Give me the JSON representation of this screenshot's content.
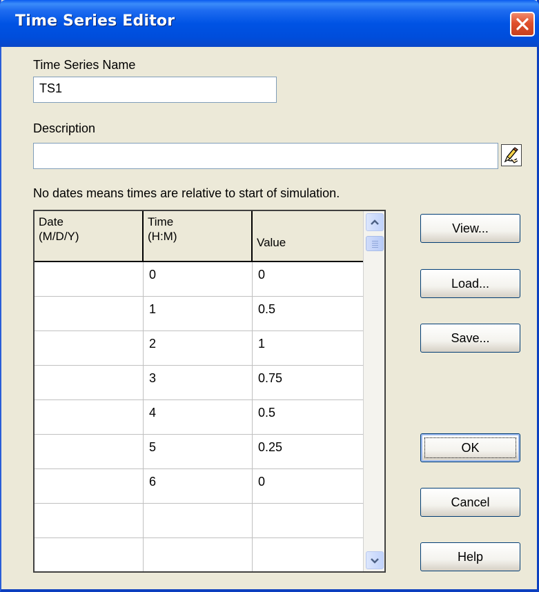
{
  "window": {
    "title": "Time Series Editor"
  },
  "name_field": {
    "label": "Time Series Name",
    "value": "TS1"
  },
  "description_field": {
    "label": "Description",
    "value": "",
    "edit_icon": "pencil-hand-icon"
  },
  "note": "No dates means times are relative to start of simulation.",
  "grid": {
    "columns": [
      {
        "line1": "Date",
        "line2": "(M/D/Y)"
      },
      {
        "line1": "Time",
        "line2": "(H:M)"
      },
      {
        "line1": "",
        "line2": "Value"
      }
    ],
    "rows": [
      {
        "date": "",
        "time": "0",
        "value": "0"
      },
      {
        "date": "",
        "time": "1",
        "value": "0.5"
      },
      {
        "date": "",
        "time": "2",
        "value": "1"
      },
      {
        "date": "",
        "time": "3",
        "value": "0.75"
      },
      {
        "date": "",
        "time": "4",
        "value": "0.5"
      },
      {
        "date": "",
        "time": "5",
        "value": "0.25"
      },
      {
        "date": "",
        "time": "6",
        "value": "0"
      },
      {
        "date": "",
        "time": "",
        "value": ""
      },
      {
        "date": "",
        "time": "",
        "value": ""
      }
    ]
  },
  "buttons": {
    "view": "View...",
    "load": "Load...",
    "save": "Save...",
    "ok": "OK",
    "cancel": "Cancel",
    "help": "Help"
  },
  "colors": {
    "titlebar": "#0053e4",
    "dialog_bg": "#ece9d8",
    "close_button": "#e0502d"
  }
}
